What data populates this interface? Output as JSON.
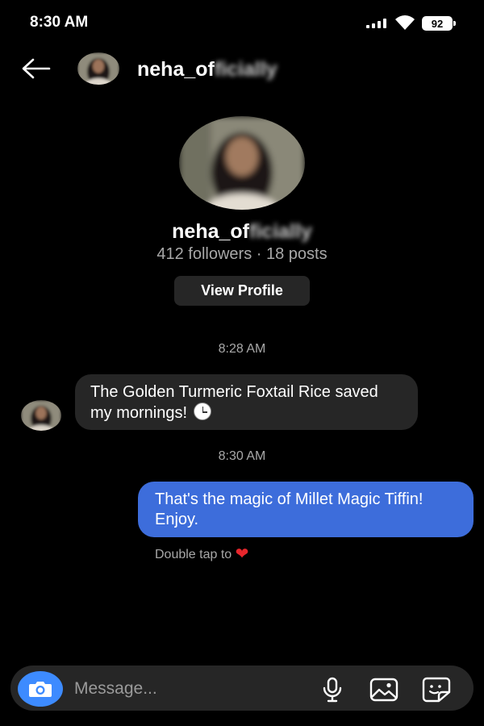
{
  "status_bar": {
    "time": "8:30 AM",
    "battery": "92"
  },
  "header": {
    "username_visible": "neha_of",
    "username_obscured": "ficially"
  },
  "profile": {
    "username_visible": "neha_of",
    "username_obscured": "ficially",
    "stats": "412 followers · 18 posts",
    "view_profile_label": "View Profile"
  },
  "messages": [
    {
      "timestamp": "8:28 AM",
      "direction": "incoming",
      "text": "The Golden Turmeric Foxtail Rice saved my mornings! ",
      "emoji": "clock-icon"
    },
    {
      "timestamp": "8:30 AM",
      "direction": "outgoing",
      "text": "That's the magic of Millet Magic Tiffin! Enjoy."
    }
  ],
  "reaction_hint": {
    "text": "Double tap to ",
    "emoji": "❤"
  },
  "composer": {
    "placeholder": "Message..."
  },
  "colors": {
    "background": "#000000",
    "incoming_bubble": "#262626",
    "outgoing_bubble": "#3d6ddb",
    "camera_button": "#3d8bff",
    "heart": "#e8262c"
  }
}
